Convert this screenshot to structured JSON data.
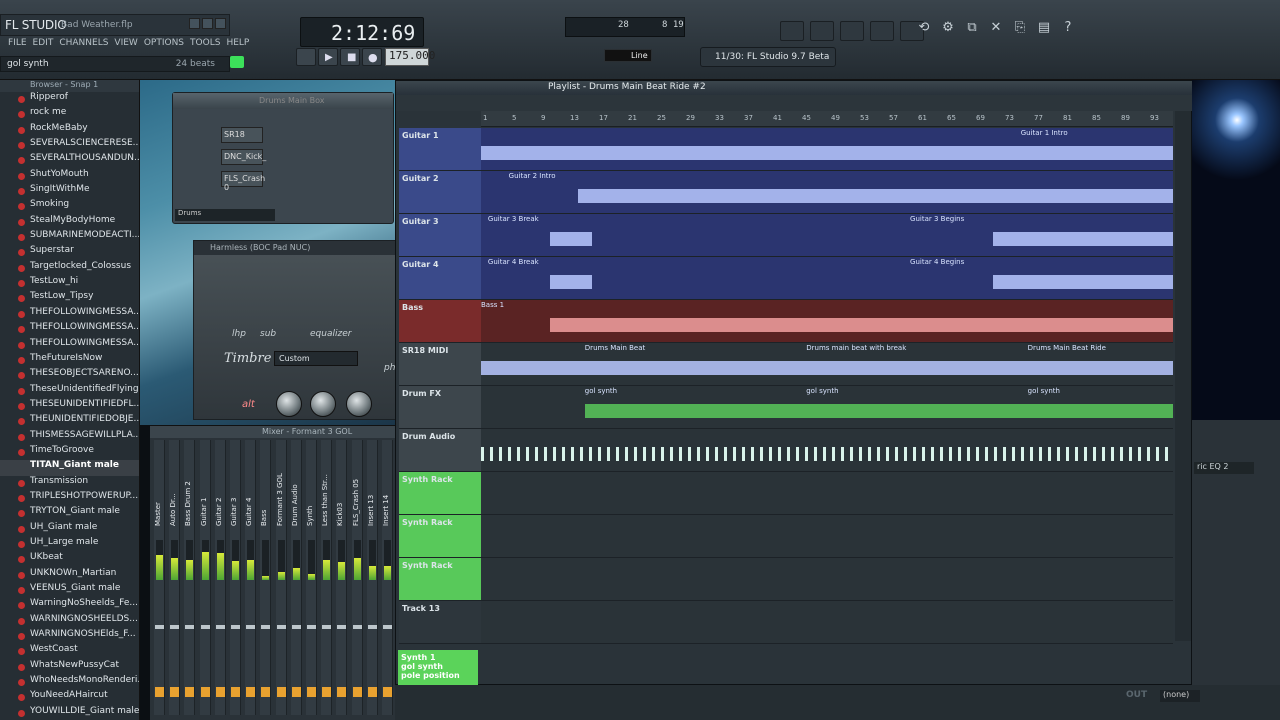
{
  "app": {
    "title": "FL STUDIO",
    "file": "Bad Weather.flp",
    "menu": [
      "FILE",
      "EDIT",
      "CHANNELS",
      "VIEW",
      "OPTIONS",
      "TOOLS",
      "HELP"
    ],
    "hint_left": "gol synth",
    "hint_right": "24 beats",
    "time": "2:12:69",
    "tempo": "175.000",
    "cpu_left": "28",
    "cpu_right": "8 19",
    "hint_bar": "11/30: FL Studio 9.7 Beta",
    "line_mode": "Line"
  },
  "browser": {
    "title": "Browser - Snap 1",
    "items": [
      "Ripperof",
      "rock me",
      "RockMeBaby",
      "SEVERALSCIENCERESE...",
      "SEVERALTHOUSANDUN...",
      "ShutYoMouth",
      "SingItWithMe",
      "Smoking",
      "StealMyBodyHome",
      "SUBMARINEMODEACTI...",
      "Superstar",
      "Targetlocked_Colossus",
      "TestLow_hi",
      "TestLow_Tipsy",
      "THEFOLLOWINGMESSA...",
      "THEFOLLOWINGMESSA...",
      "THEFOLLOWINGMESSA...",
      "TheFutureIsNow",
      "THESEOBJECTSARENO...",
      "TheseUnidentifiedFlying...",
      "THESEUNIDENTIFIEDFL...",
      "THEUNIDENTIFIEDOBJE...",
      "THISMESSAGEWILLPLA...",
      "TimeToGroove",
      "TITAN_Giant male",
      "Transmission",
      "TRIPLESHOTPOWERUP...",
      "TRYTON_Giant male",
      "UH_Giant male",
      "UH_Large male",
      "UKbeat",
      "UNKNOWn_Martian",
      "VEENUS_Giant male",
      "WarningNoSheelds_Fe...",
      "WARNINGNOSHEELDS...",
      "WARNINGNOSHElds_F...",
      "WestCoast",
      "WhatsNewPussyCat",
      "WhoNeedsMonoRenderi...",
      "YouNeedAHaircut",
      "YOUWILLDIE_Giant male"
    ],
    "selected_index": 24
  },
  "drumbox": {
    "title": "Drums Main Box",
    "channels": [
      "SR18",
      "DNC_Kick_",
      "FLS_Crash 0"
    ],
    "pattern": "Drums"
  },
  "harmless": {
    "title": "Harmless (BOC Pad NUC)",
    "labels": [
      "lhp",
      "sub",
      "equalizer"
    ],
    "timbre": "Timbre",
    "preset": "Custom",
    "alt": "alt",
    "ph": "ph"
  },
  "mixer": {
    "title": "Mixer - Formant 3 GOL",
    "strips": [
      {
        "name": "Master",
        "level": 0.62
      },
      {
        "name": "Auto Dr...",
        "level": 0.55
      },
      {
        "name": "Bass Drum 2",
        "level": 0.5
      },
      {
        "name": "Guitar 1",
        "level": 0.7
      },
      {
        "name": "Guitar 2",
        "level": 0.68
      },
      {
        "name": "Guitar 3",
        "level": 0.48
      },
      {
        "name": "Guitar 4",
        "level": 0.5
      },
      {
        "name": "Bass",
        "level": 0.1
      },
      {
        "name": "Formant 3 GOL",
        "level": 0.2
      },
      {
        "name": "Drum Audio",
        "level": 0.3
      },
      {
        "name": "Synth",
        "level": 0.15
      },
      {
        "name": "Less than Str...",
        "level": 0.5
      },
      {
        "name": "Kick03",
        "level": 0.45
      },
      {
        "name": "FLS_Crash 05",
        "level": 0.55
      },
      {
        "name": "Insert 13",
        "level": 0.35
      },
      {
        "name": "Insert 14",
        "level": 0.35
      }
    ]
  },
  "playlist": {
    "title": "Playlist - Drums Main Beat Ride #2",
    "ruler": [
      "1",
      "5",
      "9",
      "13",
      "17",
      "21",
      "25",
      "29",
      "33",
      "37",
      "41",
      "45",
      "49",
      "53",
      "57",
      "61",
      "65",
      "69",
      "73",
      "77",
      "81",
      "85",
      "89",
      "93"
    ],
    "tracks": [
      {
        "name": "Guitar 1",
        "color": "#3a4a8a",
        "clips": [
          {
            "label": "Guitar 1 Intro",
            "x": 0.78,
            "start": 0,
            "end": 1
          }
        ]
      },
      {
        "name": "Guitar 2",
        "color": "#3a4a8a",
        "clips": [
          {
            "label": "Guitar 2 Intro",
            "x": 0.04,
            "start": 0.14,
            "end": 1
          }
        ]
      },
      {
        "name": "Guitar 3",
        "color": "#3a4a8a",
        "clips": [
          {
            "label": "Guitar 3 Break",
            "x": 0.01,
            "start": 0.1,
            "end": 0.16
          },
          {
            "label": "Guitar 3 Begins",
            "x": 0.62,
            "start": 0.74,
            "end": 1
          }
        ]
      },
      {
        "name": "Guitar 4",
        "color": "#3a4a8a",
        "clips": [
          {
            "label": "Guitar 4 Break",
            "x": 0.01,
            "start": 0.1,
            "end": 0.16
          },
          {
            "label": "Guitar 4 Begins",
            "x": 0.62,
            "start": 0.74,
            "end": 1
          }
        ]
      },
      {
        "name": "Bass",
        "color": "#7a2b2b",
        "clips": [
          {
            "label": "Bass 1",
            "x": 0.0,
            "start": 0.1,
            "end": 1
          }
        ]
      },
      {
        "name": "SR18 MIDI",
        "color": "#3d464c",
        "clips": [
          {
            "label": "Drums Main Beat",
            "x": 0.15,
            "start": 0,
            "end": 1
          },
          {
            "label": "Drums main beat with break",
            "x": 0.47,
            "start": 0,
            "end": 0
          },
          {
            "label": "Drums Main Beat Ride",
            "x": 0.79,
            "start": 0,
            "end": 0
          }
        ]
      },
      {
        "name": "Drum FX",
        "color": "#3d464c",
        "clips": [
          {
            "label": "gol synth",
            "x": 0.15,
            "start": 0.15,
            "end": 1
          },
          {
            "label": "gol synth",
            "x": 0.47,
            "start": 0,
            "end": 0
          },
          {
            "label": "gol synth",
            "x": 0.79,
            "start": 0,
            "end": 0
          }
        ]
      },
      {
        "name": "Drum Audio",
        "color": "#3d464c",
        "clips": []
      },
      {
        "name": "Synth Rack",
        "color": "#58c95a",
        "clips": []
      },
      {
        "name": "Synth Rack",
        "color": "#58c95a",
        "clips": []
      },
      {
        "name": "Synth Rack",
        "color": "#58c95a",
        "clips": []
      },
      {
        "name": "Track 13",
        "color": "#2d363c",
        "clips": []
      }
    ],
    "bottom_cell": [
      "Synth 1",
      "gol synth",
      "pole position"
    ]
  },
  "right": {
    "eq": "ric EQ 2",
    "none": "(none)",
    "out": "OUT"
  },
  "colors": {
    "accent_green": "#5bd35a",
    "wave_blue": "#b9c8ff",
    "wave_red": "#f2a0a0",
    "wave_audio": "#d9f3ea"
  }
}
